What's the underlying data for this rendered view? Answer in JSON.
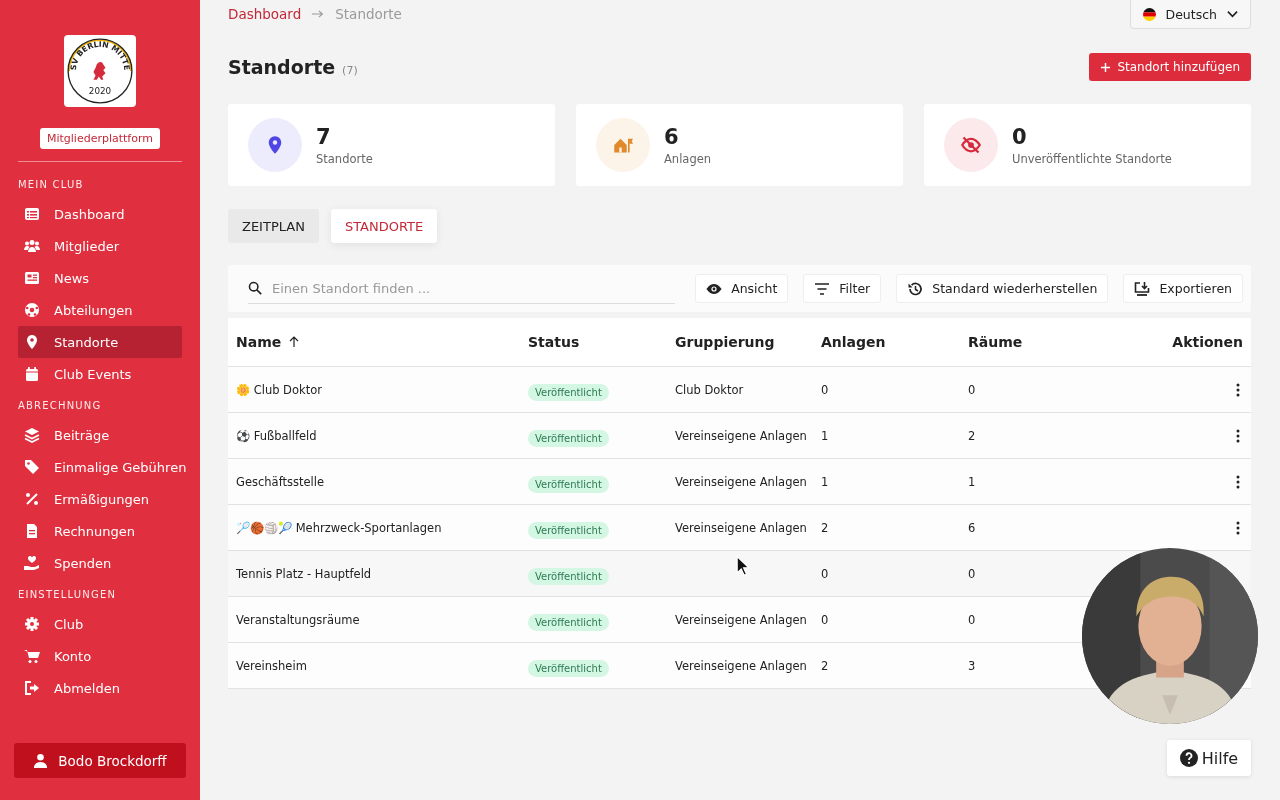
{
  "sidebar": {
    "logo": {
      "text": "SV BERLIN MITTE",
      "year": "2020"
    },
    "badge": "Mitgliederplattform",
    "sections": [
      {
        "title": "MEIN CLUB",
        "items": [
          {
            "label": "Dashboard",
            "selected": false
          },
          {
            "label": "Mitglieder",
            "selected": false
          },
          {
            "label": "News",
            "selected": false
          },
          {
            "label": "Abteilungen",
            "selected": false
          },
          {
            "label": "Standorte",
            "selected": true
          },
          {
            "label": "Club Events",
            "selected": false
          }
        ]
      },
      {
        "title": "ABRECHNUNG",
        "items": [
          {
            "label": "Beiträge",
            "selected": false
          },
          {
            "label": "Einmalige Gebühren",
            "selected": false
          },
          {
            "label": "Ermäßigungen",
            "selected": false
          },
          {
            "label": "Rechnungen",
            "selected": false
          },
          {
            "label": "Spenden",
            "selected": false
          }
        ]
      },
      {
        "title": "EINSTELLUNGEN",
        "items": [
          {
            "label": "Club",
            "selected": false
          },
          {
            "label": "Konto",
            "selected": false
          },
          {
            "label": "Abmelden",
            "selected": false
          }
        ]
      }
    ],
    "user": "Bodo Brockdorff"
  },
  "breadcrumb": [
    "Dashboard",
    "Standorte"
  ],
  "language": "Deutsch",
  "page": {
    "title": "Standorte",
    "count": "(7)",
    "add_button": "Standort hinzufügen"
  },
  "stats": [
    {
      "value": "7",
      "label": "Standorte",
      "color": "#4f46e5"
    },
    {
      "value": "6",
      "label": "Anlagen",
      "color": "#e08a2c"
    },
    {
      "value": "0",
      "label": "Unveröffentlichte Standorte",
      "color": "#d52b3c"
    }
  ],
  "tabs": [
    {
      "label": "ZEITPLAN",
      "selected": false
    },
    {
      "label": "STANDORTE",
      "selected": true
    }
  ],
  "search": {
    "placeholder": "Einen Standort finden ..."
  },
  "toolbar": [
    "Ansicht",
    "Filter",
    "Standard wiederherstellen",
    "Exportieren"
  ],
  "table": {
    "columns": [
      "Name",
      "Status",
      "Gruppierung",
      "Anlagen",
      "Räume",
      "Aktionen"
    ],
    "rows": [
      {
        "name": "🌼 Club Doktor",
        "status": "Veröffentlicht",
        "group": "Club Doktor",
        "anlagen": "0",
        "raeume": "0",
        "actions": true
      },
      {
        "name": "⚽ Fußballfeld",
        "status": "Veröffentlicht",
        "group": "Vereinseigene Anlagen",
        "anlagen": "1",
        "raeume": "2",
        "actions": true
      },
      {
        "name": "Geschäftsstelle",
        "status": "Veröffentlicht",
        "group": "Vereinseigene Anlagen",
        "anlagen": "1",
        "raeume": "1",
        "actions": true
      },
      {
        "name": "🏸🏀🏐🎾 Mehrzweck-Sportanlagen",
        "status": "Veröffentlicht",
        "group": "Vereinseigene Anlagen",
        "anlagen": "2",
        "raeume": "6",
        "actions": true
      },
      {
        "name": "Tennis Platz - Hauptfeld",
        "status": "Veröffentlicht",
        "anlagen": "0",
        "raeume": "0",
        "actions": false
      },
      {
        "name": "Veranstaltungsräume",
        "status": "Veröffentlicht",
        "group": "Vereinseigene Anlagen",
        "anlagen": "0",
        "raeume": "0",
        "actions": false
      },
      {
        "name": "Vereinsheim",
        "status": "Veröffentlicht",
        "group": "Vereinseigene Anlagen",
        "anlagen": "2",
        "raeume": "3",
        "actions": false
      }
    ]
  },
  "webcam": {
    "kind": "picture"
  },
  "help_button": "Hilfe"
}
